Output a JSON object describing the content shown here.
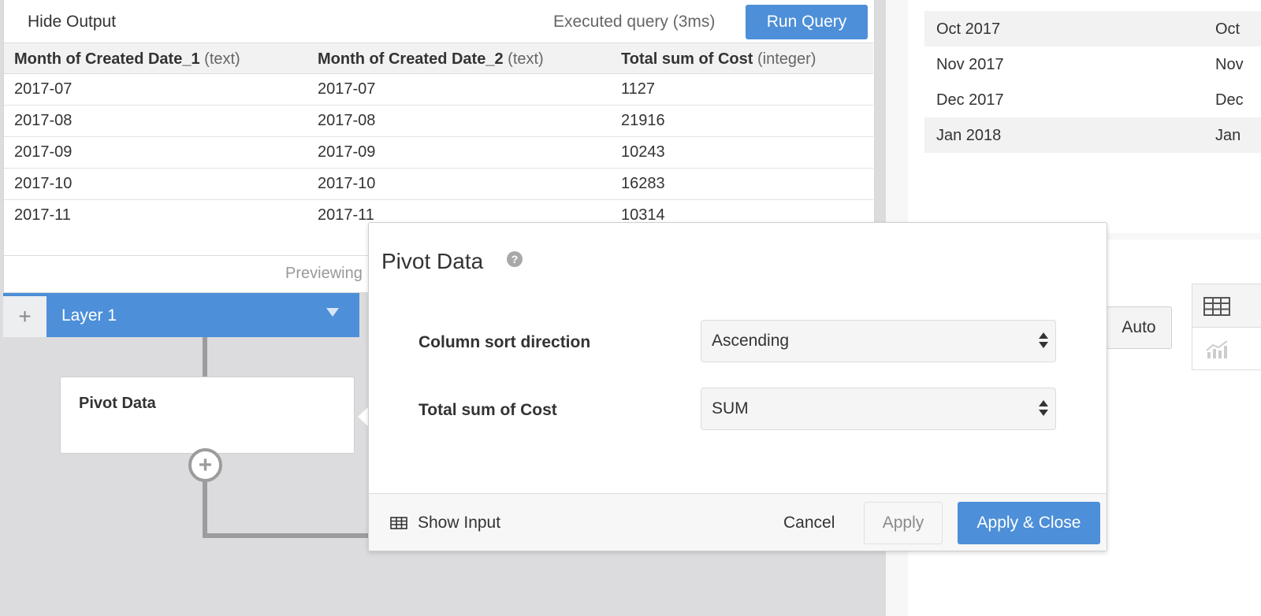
{
  "output": {
    "hide_output_label": "Hide Output",
    "exec_status": "Executed query (3ms)",
    "run_query_label": "Run Query",
    "columns": [
      {
        "name": "Month of Created Date_1",
        "type": "(text)"
      },
      {
        "name": "Month of Created Date_2",
        "type": "(text)"
      },
      {
        "name": "Total sum of Cost",
        "type": "(integer)"
      }
    ],
    "rows": [
      [
        "2017-07",
        "2017-07",
        "1127"
      ],
      [
        "2017-08",
        "2017-08",
        "21916"
      ],
      [
        "2017-09",
        "2017-09",
        "10243"
      ],
      [
        "2017-10",
        "2017-10",
        "16283"
      ],
      [
        "2017-11",
        "2017-11",
        "10314"
      ]
    ],
    "previewing_text": "Previewing"
  },
  "layer": {
    "add_icon": "+",
    "name": "Layer 1"
  },
  "flow": {
    "node_label": "Pivot Data",
    "add_step_icon": "+"
  },
  "right": {
    "rows": [
      [
        "Oct 2017",
        "Oct"
      ],
      [
        "Nov 2017",
        "Nov"
      ],
      [
        "Dec 2017",
        "Dec"
      ],
      [
        "Jan 2018",
        "Jan"
      ]
    ],
    "auto_label": "Auto"
  },
  "modal": {
    "title": "Pivot Data",
    "help_icon": "?",
    "fields": [
      {
        "label": "Column sort direction",
        "value": "Ascending"
      },
      {
        "label": "Total sum of Cost",
        "value": "SUM"
      }
    ],
    "show_input_label": "Show Input",
    "cancel_label": "Cancel",
    "apply_label": "Apply",
    "apply_close_label": "Apply & Close"
  },
  "colors": {
    "accent": "#4d8fd8",
    "connector": "#9c9c9c"
  }
}
